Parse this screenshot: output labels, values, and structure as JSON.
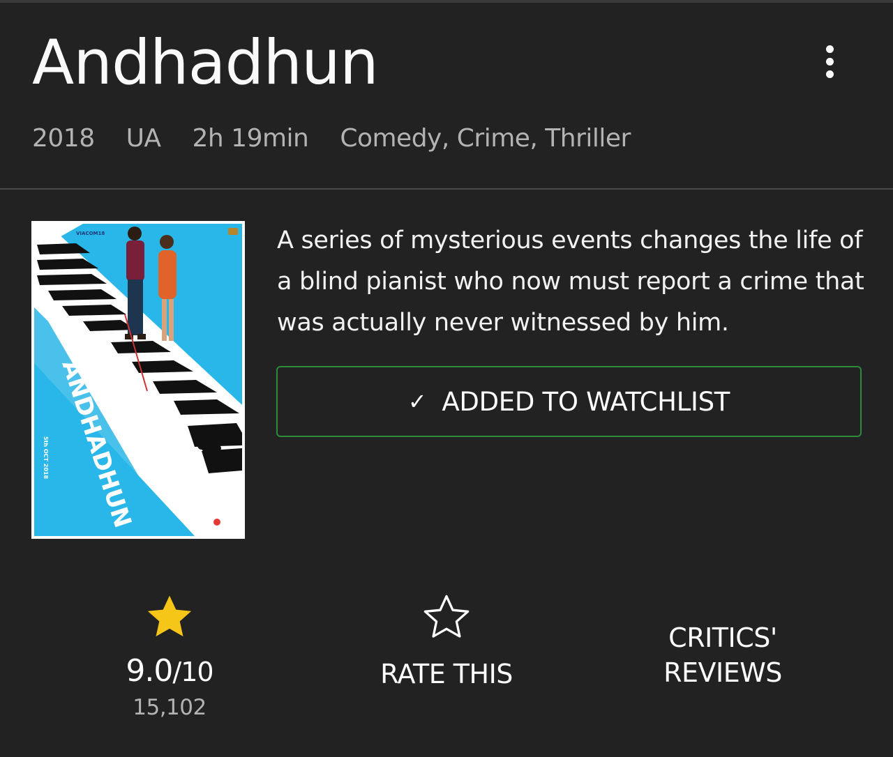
{
  "movie": {
    "title": "Andhadhun",
    "year": "2018",
    "certificate": "UA",
    "runtime": "2h 19min",
    "genres": "Comedy, Crime, Thriller",
    "description": "A series of mysterious events changes the life of a blind pianist who now must report a crime that was actually never witnessed by him.",
    "poster": {
      "studio_text": "VIACOM18",
      "poster_title": "ANDHADHUN",
      "release_text": "5th OCT 2018"
    }
  },
  "actions": {
    "watchlist_label": "ADDED TO WATCHLIST",
    "watchlist_icon": "check-icon",
    "rate_label": "RATE THIS",
    "critics_line1": "CRITICS'",
    "critics_line2": "REVIEWS"
  },
  "rating": {
    "value": "9.0",
    "denominator": "/10",
    "count": "15,102"
  },
  "colors": {
    "background": "#222222",
    "star_gold": "#f5c518",
    "watchlist_border": "#2e8b3a",
    "secondary_text": "#b3b3b3"
  }
}
